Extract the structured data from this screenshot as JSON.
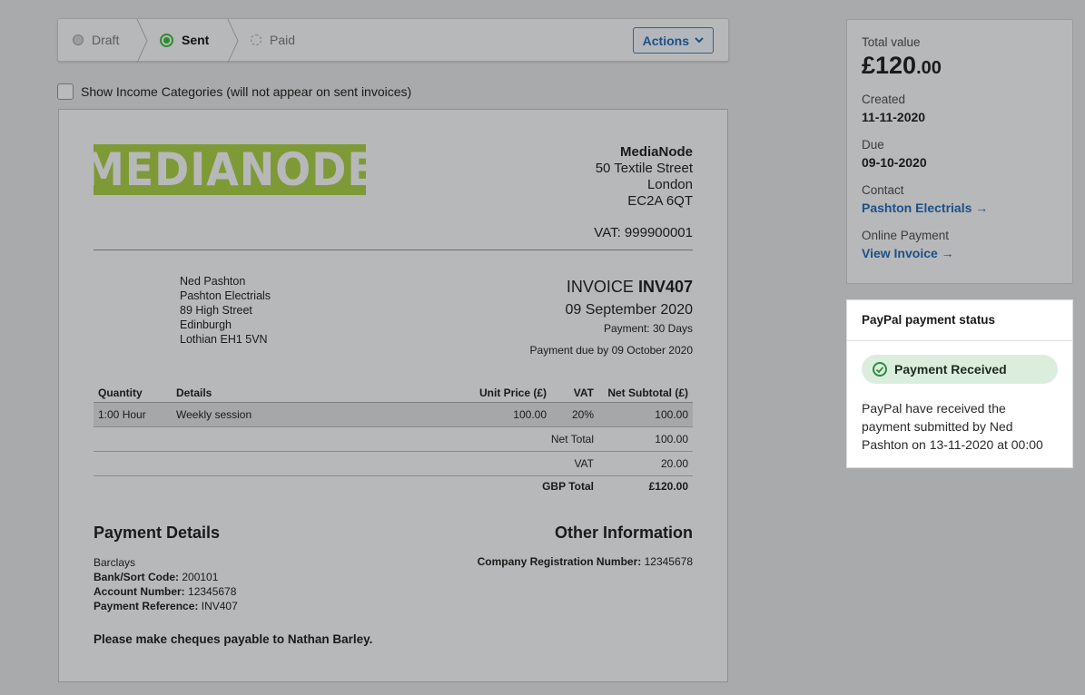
{
  "status_bar": {
    "steps": [
      {
        "label": "Draft"
      },
      {
        "label": "Sent"
      },
      {
        "label": "Paid"
      }
    ],
    "actions_label": "Actions"
  },
  "show_income_categories_label": "Show Income Categories (will not appear on sent invoices)",
  "invoice": {
    "logo_text": "MEDIANODE",
    "from": {
      "name": "MediaNode",
      "street": "50 Textile Street",
      "city": "London",
      "postcode": "EC2A 6QT",
      "vat": "VAT: 999900001"
    },
    "to": {
      "name": "Ned Pashton",
      "company": "Pashton Electrials",
      "street": "89 High Street",
      "city": "Edinburgh",
      "region": "Lothian EH1 5VN"
    },
    "title_prefix": "INVOICE",
    "number": "INV407",
    "date": "09 September 2020",
    "terms": "Payment: 30 Days",
    "due_text": "Payment due by 09 October 2020",
    "columns": [
      "Quantity",
      "Details",
      "Unit Price (£)",
      "VAT",
      "Net Subtotal (£)"
    ],
    "rows": [
      {
        "quantity": "1:00 Hour",
        "details": "Weekly session",
        "unit_price": "100.00",
        "vat": "20%",
        "subtotal": "100.00"
      }
    ],
    "net_total_label": "Net Total",
    "net_total": "100.00",
    "vat_label": "VAT",
    "vat_total": "20.00",
    "grand_total_label": "GBP Total",
    "grand_total": "£120.00",
    "payment_details": {
      "heading": "Payment Details",
      "bank": "Barclays",
      "sort_code_label": "Bank/Sort Code:",
      "sort_code": "200101",
      "account_label": "Account Number:",
      "account": "12345678",
      "reference_label": "Payment Reference:",
      "reference": "INV407"
    },
    "other_information": {
      "heading": "Other Information",
      "reg_label": "Company Registration Number:",
      "reg": "12345678"
    },
    "cheques_note": "Please make cheques payable to Nathan Barley."
  },
  "summary": {
    "total_label": "Total value",
    "total_main": "£120",
    "total_pence": ".00",
    "created_label": "Created",
    "created": "11-11-2020",
    "due_label": "Due",
    "due": "09-10-2020",
    "contact_label": "Contact",
    "contact": "Pashton Electrials →",
    "online_label": "Online Payment",
    "online_link": "View Invoice →"
  },
  "paypal": {
    "heading": "PayPal payment status",
    "badge": "Payment Received",
    "text": "PayPal have received the payment submitted by Ned Pashton on 13-11-2020 at 00:00"
  },
  "colors": {
    "brand_green": "#7e9a37",
    "link_blue": "#1d4f87",
    "success_green": "#2e8b3c"
  }
}
